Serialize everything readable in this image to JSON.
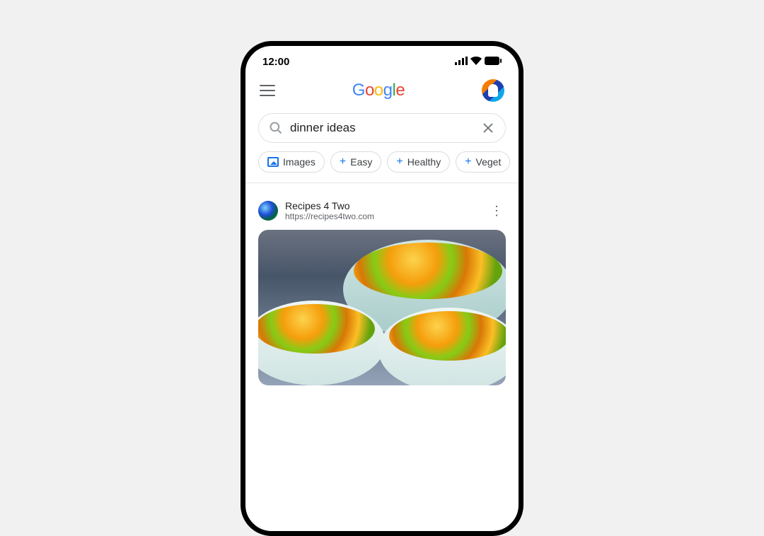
{
  "status_bar": {
    "time": "12:00"
  },
  "header": {
    "logo": "Google"
  },
  "search": {
    "query": "dinner ideas"
  },
  "chips": {
    "images": "Images",
    "easy": "Easy",
    "healthy": "Healthy",
    "vegetarian": "Veget"
  },
  "result": {
    "site_name": "Recipes 4 Two",
    "site_url": "https://recipes4two.com"
  }
}
